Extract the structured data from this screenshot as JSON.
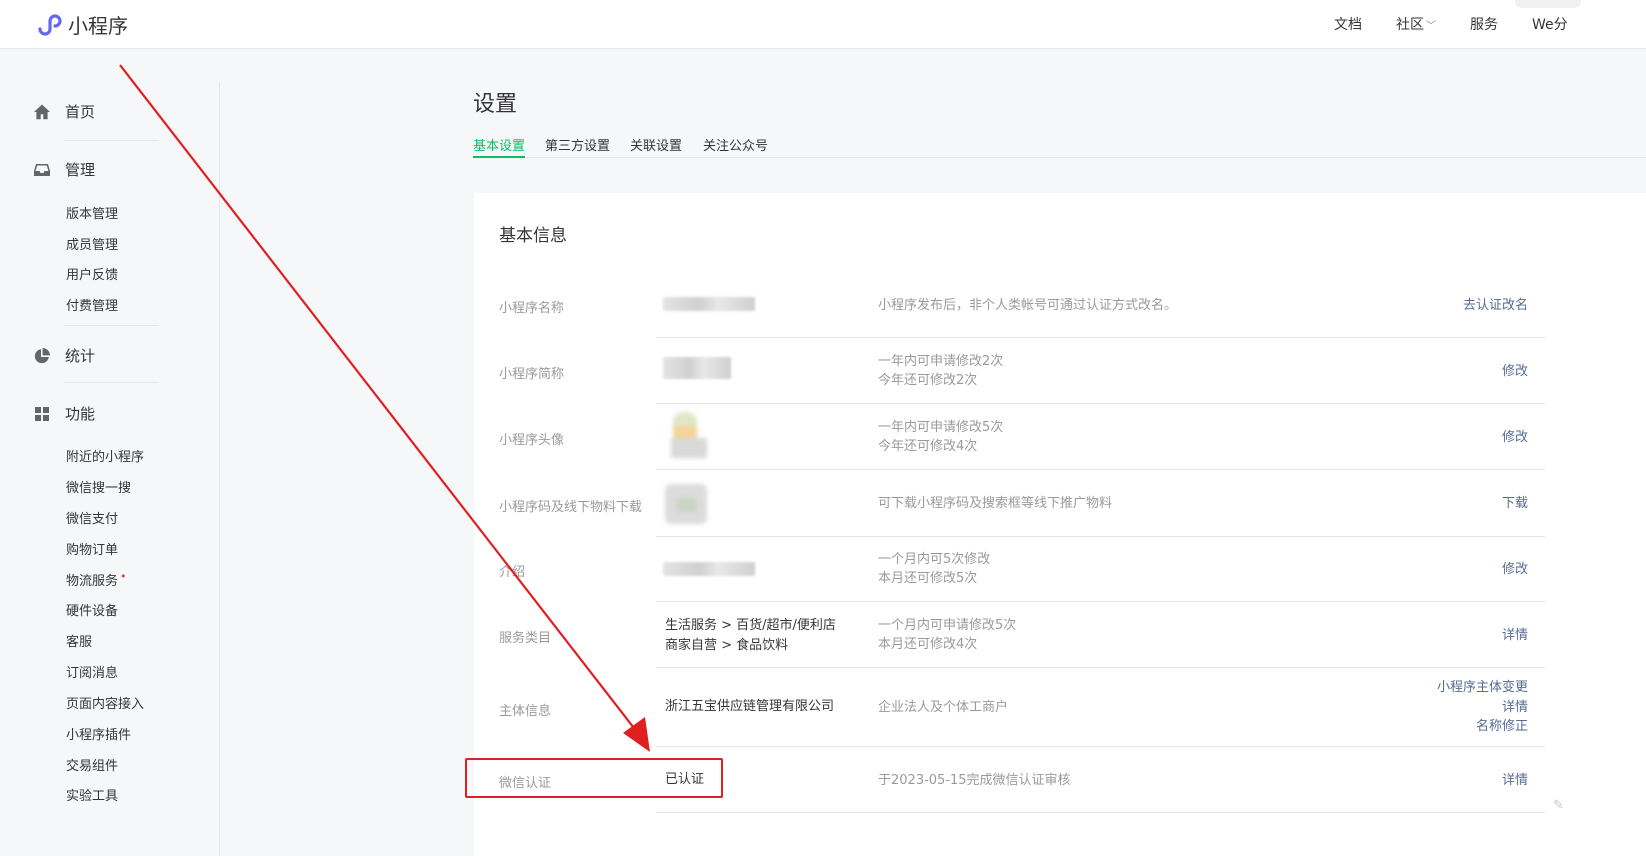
{
  "header": {
    "app_name": "小程序",
    "nav": [
      "文档",
      "社区",
      "服务",
      "We分"
    ]
  },
  "sidebar": {
    "sections": [
      {
        "label": "首页",
        "icon": "home-icon"
      },
      {
        "label": "管理",
        "icon": "inbox-icon",
        "items": [
          "版本管理",
          "成员管理",
          "用户反馈",
          "付费管理"
        ]
      },
      {
        "label": "统计",
        "icon": "pie-chart-icon"
      },
      {
        "label": "功能",
        "icon": "grid-icon",
        "items": [
          "附近的小程序",
          "微信搜一搜",
          "微信支付",
          "购物订单",
          "物流服务",
          "硬件设备",
          "客服",
          "订阅消息",
          "页面内容接入",
          "小程序插件",
          "交易组件",
          "实验工具"
        ]
      }
    ],
    "logistics_badge": "•"
  },
  "page": {
    "title": "设置",
    "tabs": [
      "基本设置",
      "第三方设置",
      "关联设置",
      "关注公众号"
    ],
    "active_tab": "基本设置"
  },
  "basic_info": {
    "title": "基本信息",
    "rows": [
      {
        "label": "小程序名称",
        "value": "",
        "desc": [
          "小程序发布后，非个人类帐号可通过认证方式改名。"
        ],
        "actions": [
          "去认证改名"
        ]
      },
      {
        "label": "小程序简称",
        "value": "",
        "desc": [
          "一年内可申请修改2次",
          "今年还可修改2次"
        ],
        "actions": [
          "修改"
        ]
      },
      {
        "label": "小程序头像",
        "value": "",
        "desc": [
          "一年内可申请修改5次",
          "今年还可修改4次"
        ],
        "actions": [
          "修改"
        ]
      },
      {
        "label": "小程序码及线下物料下载",
        "value": "",
        "desc": [
          "可下载小程序码及搜索框等线下推广物料"
        ],
        "actions": [
          "下载"
        ]
      },
      {
        "label": "介绍",
        "value": "",
        "desc": [
          "一个月内可5次修改",
          "本月还可修改5次"
        ],
        "actions": [
          "修改"
        ]
      },
      {
        "label": "服务类目",
        "value_lines": [
          "生活服务 > 百货/超市/便利店",
          "商家自营 > 食品饮料"
        ],
        "desc": [
          "一个月内可申请修改5次",
          "本月还可修改4次"
        ],
        "actions": [
          "详情"
        ]
      },
      {
        "label": "主体信息",
        "value": "浙江五宝供应链管理有限公司",
        "desc": [
          "企业法人及个体工商户"
        ],
        "actions": [
          "小程序主体变更",
          "详情",
          "名称修正"
        ]
      },
      {
        "label": "微信认证",
        "value": "已认证",
        "desc": [
          "于2023-05-15完成微信认证审核"
        ],
        "actions": [
          "详情"
        ]
      }
    ]
  },
  "colors": {
    "accent": "#07c160",
    "link": "#576b95",
    "annotation": "#e02020"
  }
}
